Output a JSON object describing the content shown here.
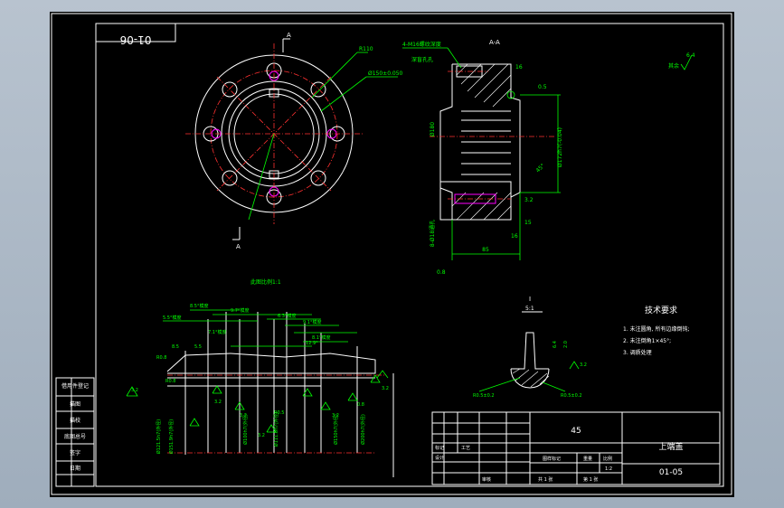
{
  "drawing": {
    "number_box": "01-06",
    "section_label": "A-A",
    "view_label_a": "A",
    "scale_note": "此图比例1:1",
    "surface_roughness_note": "其余",
    "surface_roughness_value": "6.4"
  },
  "top_view": {
    "r110_label": "R110",
    "pcd_label": "Ø150±0.050"
  },
  "section_view": {
    "thread_note": "4-M16螺纹深度",
    "thread_sub": "深盲孔孔",
    "dim_16": "16",
    "dim_85": "85",
    "dim_05": "0.5",
    "dim_phi": "Ø172h7(-0.04)",
    "dim_left": "Ø180",
    "dim_bolt": "8-Ø18通孔",
    "angle": "45°",
    "dim_32": "3.2",
    "dim_15": "15",
    "dim_16b": "16",
    "dim_b": "0.8"
  },
  "detail_view": {
    "label": "I",
    "scale": "5:1",
    "r1": "R0.5±0.2",
    "r2": "R0.5±0.2",
    "dim_a": "6.4",
    "dim_b": "2.0",
    "dim_c": "3.2"
  },
  "bottom_view": {
    "dims": [
      "8.5°模度",
      "5.5°模度",
      "9.7°模度",
      "6.3°模度",
      "9.1°模度",
      "8.1°模度",
      "12.9°",
      "7.1°模度"
    ],
    "left_labels": [
      "R0.8",
      "8.5",
      "5.5",
      "3.2"
    ],
    "vert_labels": [
      "Ø121.5h7(外径)",
      "Ø151.9h7(外径)",
      "Ø100h7(外径)",
      "Ø111.8h7(外径)",
      "Ø150h7(外径)",
      "Ø200h7(外径)"
    ],
    "r_labels": [
      "R0.8",
      "R0.5"
    ],
    "small_dims": [
      "3.2",
      "3.2",
      "3.2",
      "3.2",
      "3.2",
      "0.8"
    ]
  },
  "tech_requirements": {
    "title": "技术要求",
    "items": [
      "1. 未注圆角, 所有边缘倒钝;",
      "2. 未注倒角1×45°;",
      "3. 调质处理"
    ]
  },
  "title_block": {
    "material": "45",
    "part_name": "上端盖",
    "part_number": "01-05",
    "scale_header": "比例",
    "weight_header": "重量",
    "stage_header": "图样标记",
    "scale_value": "1:2",
    "sheet_a": "共 1 张",
    "sheet_b": "第 1 张",
    "row_labels": [
      "标记",
      "设计",
      "审核",
      "工艺"
    ],
    "left_col": [
      "借用件登记",
      "描图",
      "描校",
      "底图总号",
      "签字",
      "日期"
    ]
  }
}
